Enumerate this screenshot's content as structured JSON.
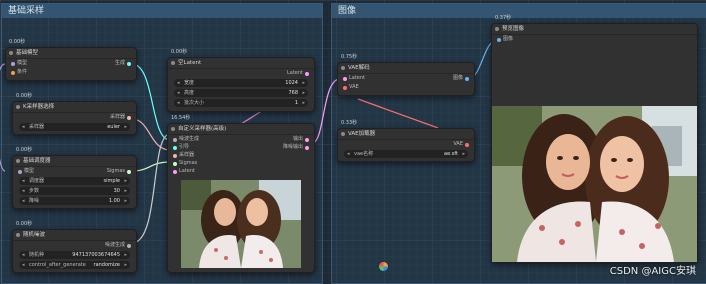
{
  "groups": {
    "left": "基础采样",
    "right": "图像"
  },
  "nodes": {
    "checkpoint": {
      "time": "0.00秒",
      "title": "基础模型",
      "inputs": [
        "模型",
        "条件"
      ],
      "output": "生成"
    },
    "sampler_select": {
      "time": "0.00秒",
      "title": "K采样器选择",
      "output": "采样器",
      "widget_label": "采样器",
      "widget_value": "euler"
    },
    "scheduler": {
      "time": "0.00秒",
      "title": "基础调度器",
      "input": "模型",
      "output": "Sigmas",
      "widgets": [
        {
          "label": "调度器",
          "value": "simple"
        },
        {
          "label": "步数",
          "value": "30"
        },
        {
          "label": "降噪",
          "value": "1.00"
        }
      ]
    },
    "noise": {
      "time": "0.00秒",
      "title": "随机噪波",
      "output": "噪波生成",
      "widgets": [
        {
          "label": "随机种",
          "value": "947137003674645"
        },
        {
          "label": "control_after_generate",
          "value": "randomize"
        }
      ]
    },
    "empty_latent": {
      "time": "0.00秒",
      "title": "空Latent",
      "output": "Latent",
      "widgets": [
        {
          "label": "宽度",
          "value": "1024"
        },
        {
          "label": "高度",
          "value": "768"
        },
        {
          "label": "批次大小",
          "value": "1"
        }
      ]
    },
    "custom_sampler": {
      "time": "16.54秒",
      "title": "自定义采样器(高级)",
      "inputs": [
        "噪波生成",
        "引导",
        "采样器",
        "Sigmas",
        "Latent"
      ],
      "outputs": [
        "输出",
        "降噪输出"
      ]
    },
    "vae_decode": {
      "time": "0.75秒",
      "title": "VAE解码",
      "inputs": [
        "Latent",
        "VAE"
      ],
      "output": "图像"
    },
    "vae_loader": {
      "time": "0.33秒",
      "title": "VAE加载器",
      "output": "VAE",
      "widget_label": "vae名称",
      "widget_value": "ae.sft"
    },
    "preview": {
      "time": "0.37秒",
      "title": "预览图像",
      "input": "图像"
    }
  },
  "watermark": "CSDN @AIGC安琪",
  "colors": {
    "model": "#b39ddb",
    "conditioning": "#f0a040",
    "latent": "#ff9cf9",
    "vae": "#ff6e6e",
    "image": "#64b5f6",
    "sampler": "#ecb4b4",
    "sigmas": "#cdffcd",
    "noise": "#b0b0b0",
    "guider": "#66ffff"
  }
}
